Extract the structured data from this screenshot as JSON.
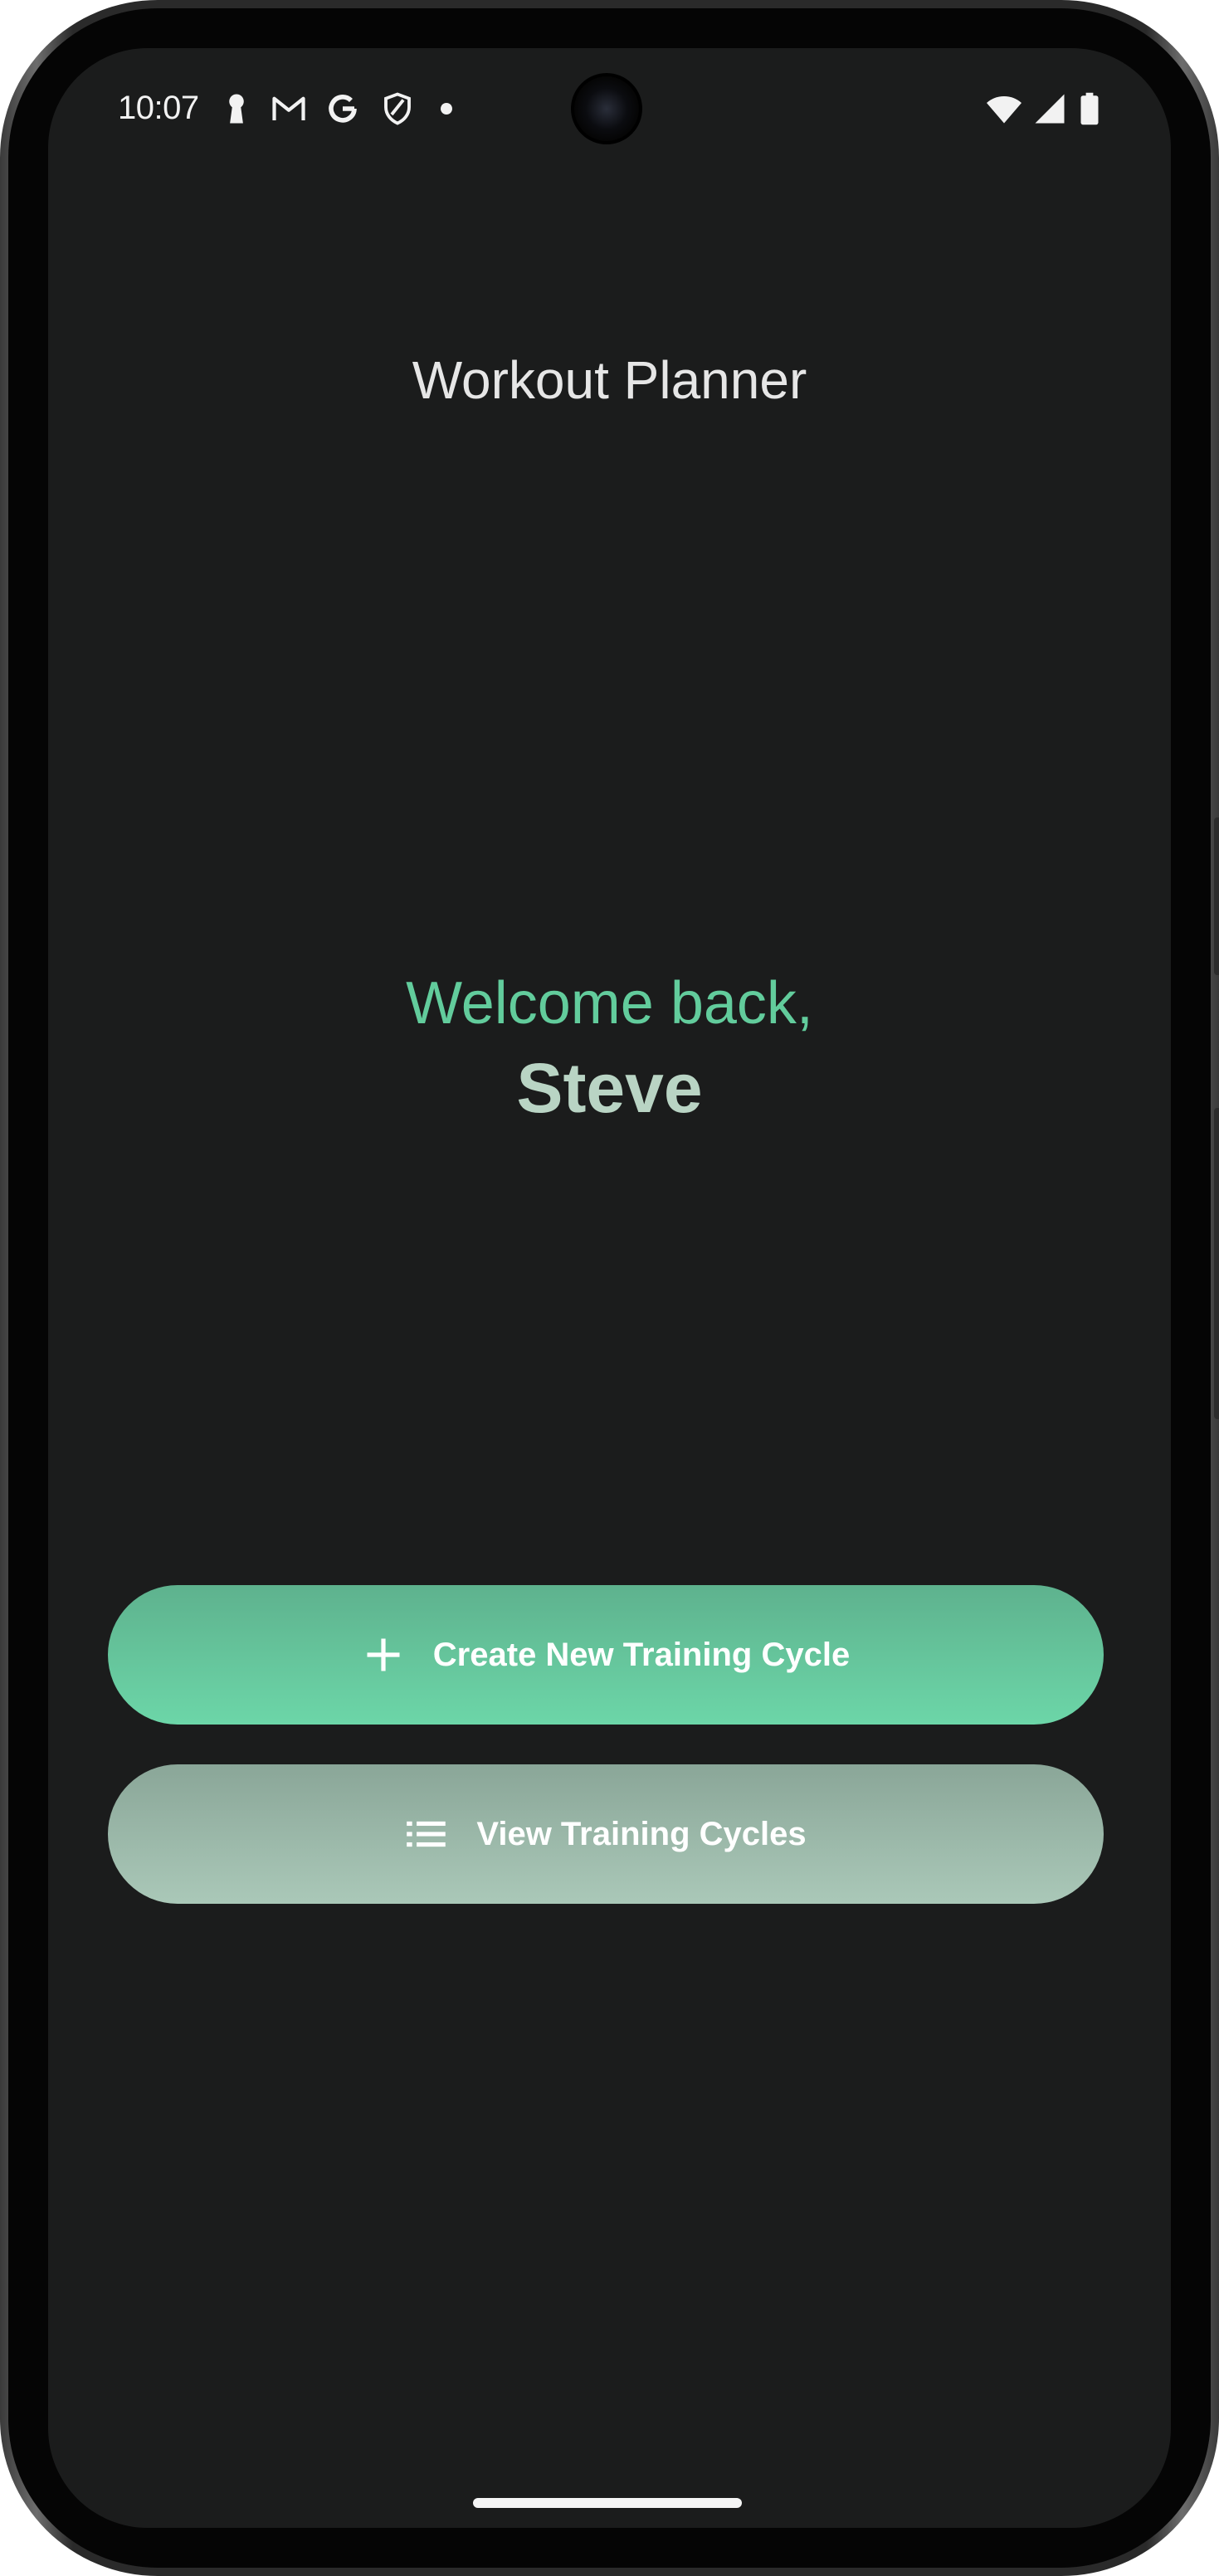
{
  "status_bar": {
    "time": "10:07",
    "left_icons": [
      "keyhole-icon",
      "gmail-icon",
      "google-icon",
      "shield-icon",
      "notification-dot-icon"
    ],
    "right_icons": [
      "wifi-icon",
      "cellular-signal-icon",
      "battery-icon"
    ]
  },
  "app": {
    "title": "Workout Planner"
  },
  "greeting": {
    "welcome": "Welcome back,",
    "name": "Steve"
  },
  "actions": {
    "create_label": "Create New Training Cycle",
    "create_icon": "plus-icon",
    "view_label": "View Training Cycles",
    "view_icon": "list-icon"
  },
  "colors": {
    "background": "#1b1c1c",
    "accent_green": "#62cc9c",
    "name_color": "#b9d4c4",
    "create_button": "#6cd6a8",
    "view_button": "#aac8b8"
  }
}
